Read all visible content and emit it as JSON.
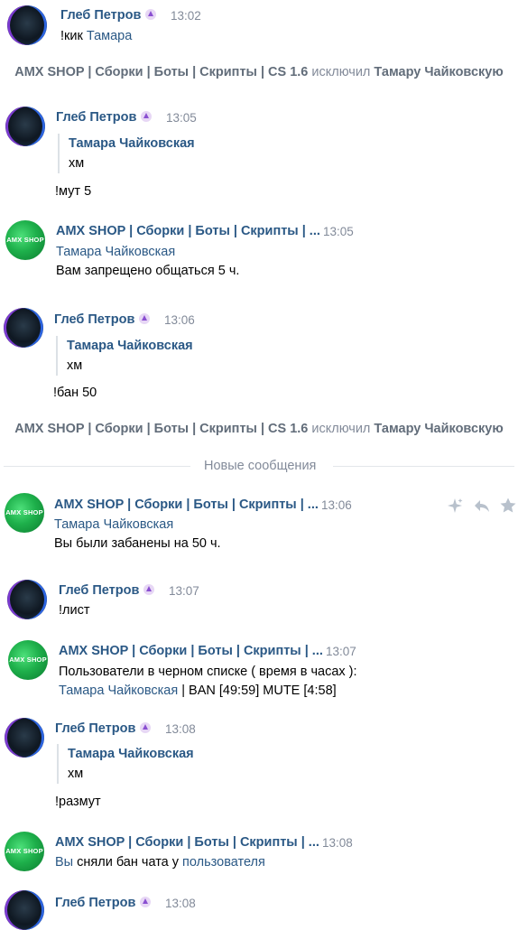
{
  "users": {
    "gleb": "Глеб Петров",
    "tamara": "Тамара Чайковская",
    "amx_full": "AMX SHOP | Сборки | Боты | Скрипты | CS 1.6",
    "amx_short": "AMX SHOP | Сборки | Боты | Скрипты | ...",
    "amx_avatar_text": "AMX SHOP"
  },
  "messages": {
    "m1": {
      "time": "13:02",
      "prefix": "!кик ",
      "mention": "Тамара"
    },
    "m2": {
      "time": "13:05",
      "quote_text": "хм",
      "text": "!мут 5"
    },
    "m3": {
      "time": "13:05",
      "text": "Вам запрещено общаться 5 ч."
    },
    "m4": {
      "time": "13:06",
      "quote_text": "хм",
      "text": "!бан 50"
    },
    "m5": {
      "time": "13:06",
      "text": "Вы были забанены на 50 ч."
    },
    "m6": {
      "time": "13:07",
      "text": "!лист"
    },
    "m7": {
      "time": "13:07",
      "line1": "Пользователи в черном списке ( время в часах ):",
      "suffix": " | BAN [49:59] MUTE [4:58]"
    },
    "m8": {
      "time": "13:08",
      "quote_text": "хм",
      "text": "!размут"
    },
    "m9": {
      "time": "13:08",
      "link1": "Вы",
      "middle": " сняли бан чата у ",
      "link2": "пользователя"
    },
    "m10": {
      "time": "13:08"
    }
  },
  "service": {
    "s1": {
      "verb": " исключил ",
      "target": "Тамару Чайковскую"
    },
    "s2": {
      "verb": " исключил ",
      "target": "Тамару Чайковскую"
    }
  },
  "divider_label": "Новые сообщения",
  "icons": [
    "sparkle-icon",
    "reply-icon",
    "star-icon"
  ],
  "colors": {
    "link": "#2a5885",
    "muted": "#828a99",
    "text": "#000000"
  }
}
